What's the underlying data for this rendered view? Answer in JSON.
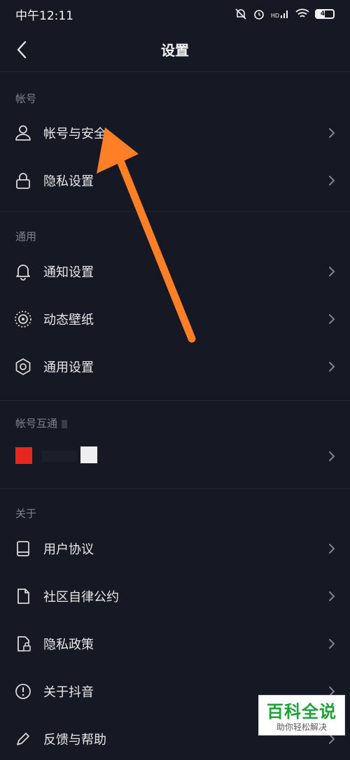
{
  "status": {
    "time": "中午12:11",
    "signal_label": "HD",
    "battery": "49"
  },
  "header": {
    "title": "设置"
  },
  "sections": {
    "account": {
      "label": "帐号",
      "items": [
        {
          "label": "帐号与安全"
        },
        {
          "label": "隐私设置"
        }
      ]
    },
    "general": {
      "label": "通用",
      "items": [
        {
          "label": "通知设置"
        },
        {
          "label": "动态壁纸"
        },
        {
          "label": "通用设置"
        }
      ]
    },
    "interop": {
      "label": "帐号互通"
    },
    "about": {
      "label": "关于",
      "items": [
        {
          "label": "用户协议"
        },
        {
          "label": "社区自律公约"
        },
        {
          "label": "隐私政策"
        },
        {
          "label": "关于抖音"
        },
        {
          "label": "反馈与帮助"
        }
      ]
    }
  },
  "watermark": {
    "title": "百科全说",
    "subtitle": "助你轻松解决"
  },
  "colors": {
    "background": "#161823",
    "arrow": "#ff7f27",
    "watermark_green": "#1fa13a",
    "red_logo": "#e4281e"
  }
}
